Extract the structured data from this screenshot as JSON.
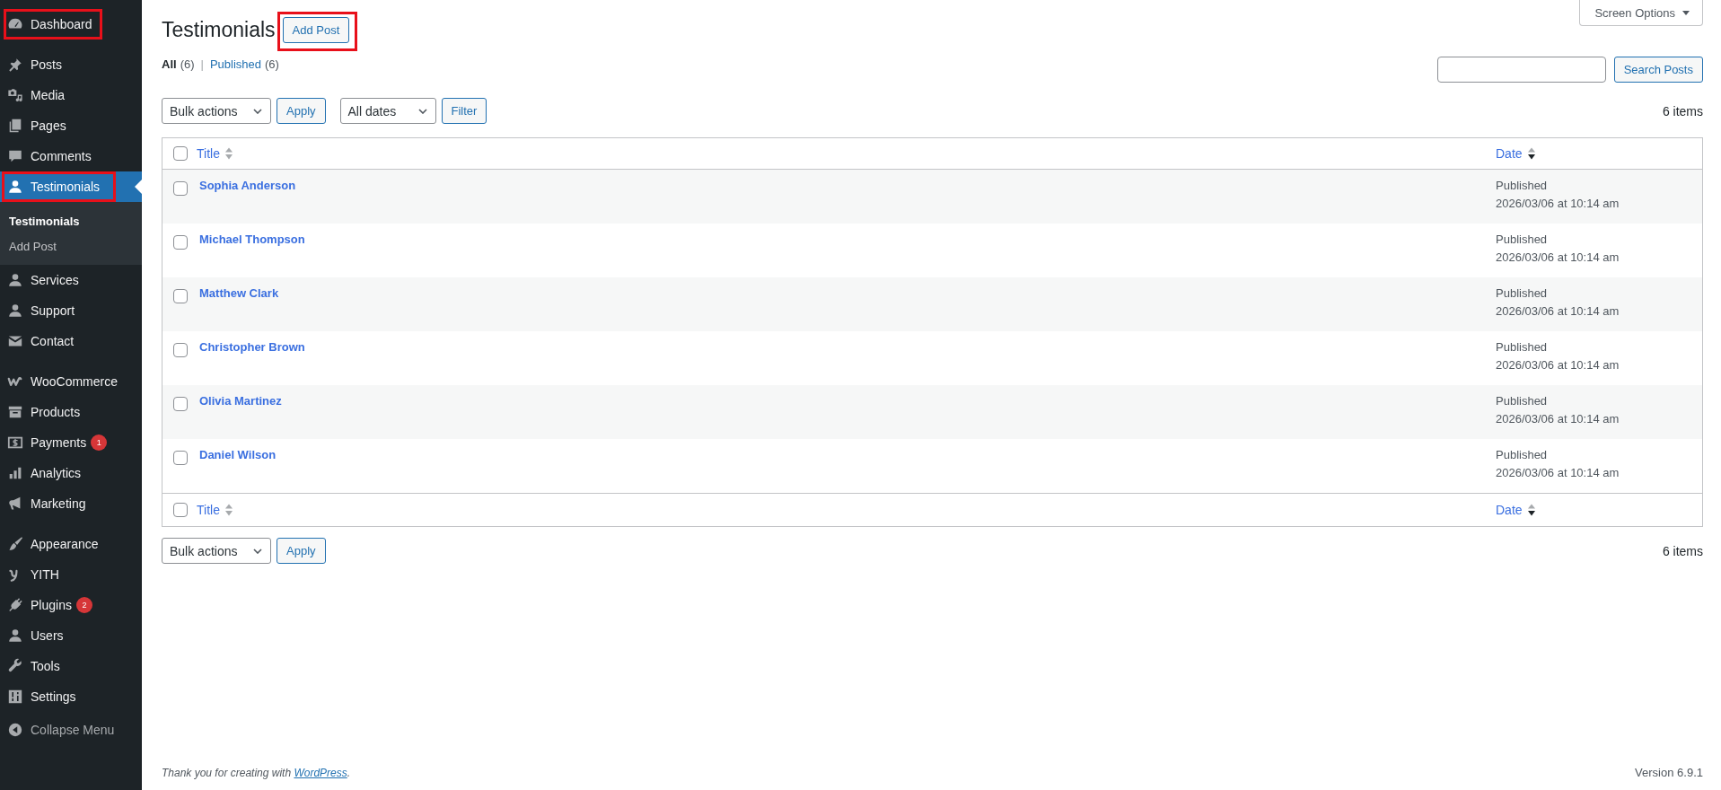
{
  "sidebar": {
    "groups": [
      {
        "items": [
          {
            "label": "Dashboard",
            "selected": false,
            "highlighted": true
          }
        ]
      },
      {
        "items": [
          {
            "label": "Posts",
            "selected": false,
            "highlighted": false
          },
          {
            "label": "Media",
            "selected": false,
            "highlighted": false
          },
          {
            "label": "Pages",
            "selected": false,
            "highlighted": false
          },
          {
            "label": "Comments",
            "selected": false,
            "highlighted": false
          },
          {
            "label": "Testimonials",
            "selected": true,
            "highlighted": true,
            "children": [
              {
                "label": "Testimonials",
                "selected": true
              },
              {
                "label": "Add Post",
                "selected": false
              }
            ]
          },
          {
            "label": "Services",
            "selected": false,
            "highlighted": false
          },
          {
            "label": "Support",
            "selected": false,
            "highlighted": false
          },
          {
            "label": "Contact",
            "selected": false,
            "highlighted": false
          }
        ]
      },
      {
        "items": [
          {
            "label": "WooCommerce",
            "selected": false,
            "highlighted": false
          },
          {
            "label": "Products",
            "selected": false,
            "highlighted": false
          },
          {
            "label": "Payments",
            "selected": false,
            "highlighted": false,
            "badge": "1"
          },
          {
            "label": "Analytics",
            "selected": false,
            "highlighted": false
          },
          {
            "label": "Marketing",
            "selected": false,
            "highlighted": false
          }
        ]
      },
      {
        "items": [
          {
            "label": "Appearance",
            "selected": false,
            "highlighted": false
          },
          {
            "label": "YITH",
            "selected": false,
            "highlighted": false
          },
          {
            "label": "Plugins",
            "selected": false,
            "highlighted": false,
            "badge": "2"
          },
          {
            "label": "Users",
            "selected": false,
            "highlighted": false
          },
          {
            "label": "Tools",
            "selected": false,
            "highlighted": false
          },
          {
            "label": "Settings",
            "selected": false,
            "highlighted": false
          }
        ]
      }
    ],
    "collapse": "Collapse Menu"
  },
  "header": {
    "title": "Testimonials",
    "add_button": {
      "label": "Add Post",
      "highlighted": true
    },
    "screen_options": "Screen Options"
  },
  "views": {
    "items": [
      {
        "label": "All",
        "count": "(6)",
        "selected": true
      },
      {
        "label": "Published",
        "count": "(6)",
        "selected": false
      }
    ],
    "separator": "|"
  },
  "search": {
    "button": "Search Posts"
  },
  "top_actions": {
    "bulk": "Bulk actions",
    "apply": "Apply",
    "dates": "All dates",
    "filter": "Filter",
    "count": "6 items"
  },
  "table": {
    "header": {
      "checked": false,
      "columns": [
        {
          "label": "Title",
          "sorted": false
        },
        {
          "label": "Date",
          "sorted": true
        }
      ]
    },
    "rows": [
      {
        "title": "Sophia Anderson",
        "status": "Published",
        "date": "2026/03/06 at 10:14 am",
        "checked": false
      },
      {
        "title": "Michael Thompson",
        "status": "Published",
        "date": "2026/03/06 at 10:14 am",
        "checked": false
      },
      {
        "title": "Matthew Clark",
        "status": "Published",
        "date": "2026/03/06 at 10:14 am",
        "checked": false
      },
      {
        "title": "Christopher Brown",
        "status": "Published",
        "date": "2026/03/06 at 10:14 am",
        "checked": false
      },
      {
        "title": "Olivia Martinez",
        "status": "Published",
        "date": "2026/03/06 at 10:14 am",
        "checked": false
      },
      {
        "title": "Daniel Wilson",
        "status": "Published",
        "date": "2026/03/06 at 10:14 am",
        "checked": false
      }
    ],
    "footer": {
      "checked": false,
      "columns": [
        {
          "label": "Title",
          "sorted": false
        },
        {
          "label": "Date",
          "sorted": true
        }
      ]
    }
  },
  "bottom_actions": {
    "bulk": "Bulk actions",
    "apply": "Apply",
    "count": "6 items"
  },
  "footer": {
    "credit_before": "Thank you for creating with ",
    "link": "WordPress",
    "credit_after": ".",
    "version": "Version 6.9.1"
  }
}
